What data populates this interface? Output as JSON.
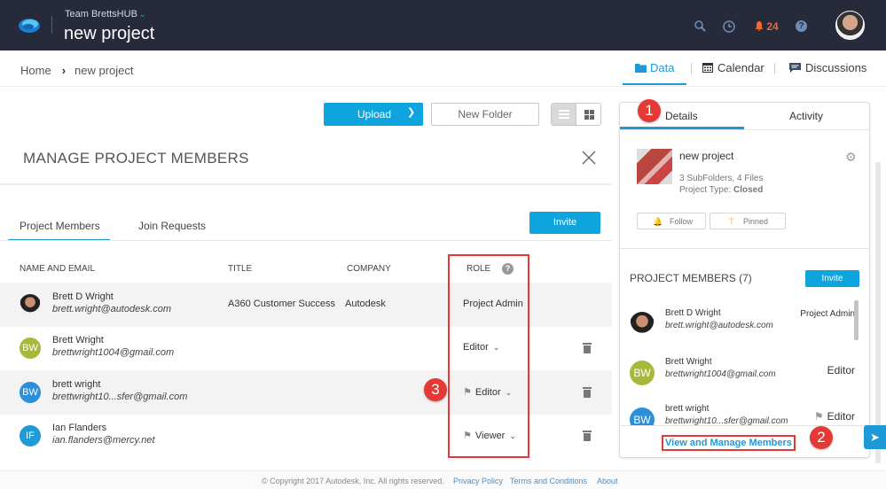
{
  "header": {
    "team": "Team BrettsHUB",
    "project_title": "new project",
    "notification_count": "24",
    "icons": [
      "search-icon",
      "history-icon",
      "bell-icon",
      "help-icon"
    ]
  },
  "breadcrumb": {
    "home": "Home",
    "current": "new project"
  },
  "subnav": {
    "data": "Data",
    "calendar": "Calendar",
    "discussions": "Discussions"
  },
  "toolbar": {
    "upload": "Upload",
    "new_folder": "New Folder"
  },
  "modal": {
    "title": "MANAGE PROJECT MEMBERS",
    "tabs": [
      "Project Members",
      "Join Requests"
    ],
    "invite": "Invite",
    "columns": {
      "name": "NAME AND EMAIL",
      "title": "TITLE",
      "company": "COMPANY",
      "role": "ROLE"
    },
    "rows": [
      {
        "initials": "",
        "name": "Brett D Wright",
        "email": "brett.wright@autodesk.com",
        "title": "A360 Customer Success",
        "company": "Autodesk",
        "role": "Project Admin",
        "avatar_color": "",
        "flag": false,
        "dropdown": false,
        "deletable": false
      },
      {
        "initials": "BW",
        "name": "Brett Wright",
        "email": "brettwright1004@gmail.com",
        "title": "",
        "company": "",
        "role": "Editor",
        "avatar_color": "#a8b93a",
        "flag": false,
        "dropdown": true,
        "deletable": true
      },
      {
        "initials": "BW",
        "name": "brett wright",
        "email": "brettwright10...sfer@gmail.com",
        "title": "",
        "company": "",
        "role": "Editor",
        "avatar_color": "#2b8fd9",
        "flag": true,
        "dropdown": true,
        "deletable": true
      },
      {
        "initials": "IF",
        "name": "Ian Flanders",
        "email": "ian.flanders@mercy.net",
        "title": "",
        "company": "",
        "role": "Viewer",
        "avatar_color": "#1f9bd8",
        "flag": true,
        "dropdown": true,
        "deletable": true
      }
    ]
  },
  "panel": {
    "tabs": [
      "Details",
      "Activity"
    ],
    "project_name": "new project",
    "summary": "3 SubFolders, 4 Files",
    "project_type_label": "Project Type: ",
    "project_type": "Closed",
    "follow": "Follow",
    "pinned": "Pinned",
    "members_title": "PROJECT MEMBERS (7)",
    "invite": "Invite",
    "members": [
      {
        "initials": "",
        "name": "Brett D Wright",
        "email": "brett.wright@autodesk.com",
        "role": "Project Admin",
        "avatar_color": ""
      },
      {
        "initials": "BW",
        "name": "Brett Wright",
        "email": "brettwright1004@gmail.com",
        "role": "Editor",
        "avatar_color": "#a8b93a"
      },
      {
        "initials": "BW",
        "name": "brett wright",
        "email": "brettwright10...sfer@gmail.com",
        "role": "Editor",
        "avatar_color": "#2b8fd9"
      }
    ],
    "view_manage": "View and Manage Members"
  },
  "annotations": [
    "1",
    "2",
    "3"
  ],
  "footer": {
    "copyright": "© Copyright 2017 Autodesk, Inc. All rights reserved.",
    "privacy": "Privacy Policy",
    "terms": "Terms and Conditions",
    "about": "About"
  },
  "colors": {
    "accent": "#1d9ad6",
    "topbar": "#262a3b",
    "annotation": "#e53935",
    "notification": "#f0682a"
  }
}
